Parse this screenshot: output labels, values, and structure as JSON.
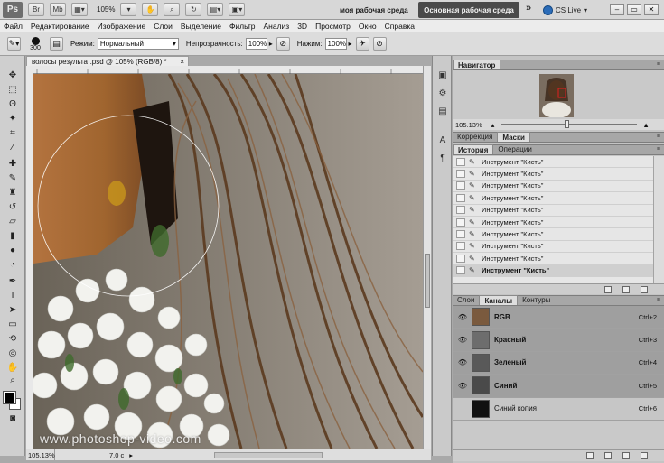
{
  "app": {
    "logo": "Ps",
    "zoom": "105%",
    "current_workspace": "моя рабочая среда",
    "workspace_button": "Основная рабочая среда",
    "more": "»",
    "cs_live": "CS Live"
  },
  "menu": [
    "Файл",
    "Редактирование",
    "Изображение",
    "Слои",
    "Выделение",
    "Фильтр",
    "Анализ",
    "3D",
    "Просмотр",
    "Окно",
    "Справка"
  ],
  "options": {
    "brush_size": "300",
    "mode_label": "Режим:",
    "mode_value": "Нормальный",
    "opacity_label": "Непрозрачность:",
    "opacity_value": "100%",
    "pressure_label": "Нажим:",
    "pressure_value": "100%"
  },
  "document": {
    "tab_title": "волосы результат.psd @ 105% (RGB/8) *",
    "close": "×",
    "status_zoom": "105.13%",
    "status_doc": "7,0 с",
    "watermark": "www.photoshop-video.com"
  },
  "navigator": {
    "title": "Навигатор",
    "zoom": "105.13%"
  },
  "panel_tabs_corr": [
    "Коррекция",
    "Маски"
  ],
  "panel_tabs_hist": [
    "История",
    "Операции"
  ],
  "history": [
    "Инструмент \"Кисть\"",
    "Инструмент \"Кисть\"",
    "Инструмент \"Кисть\"",
    "Инструмент \"Кисть\"",
    "Инструмент \"Кисть\"",
    "Инструмент \"Кисть\"",
    "Инструмент \"Кисть\"",
    "Инструмент \"Кисть\"",
    "Инструмент \"Кисть\"",
    "Инструмент \"Кисть\""
  ],
  "panel_tabs_layers": [
    "Слои",
    "Каналы",
    "Контуры"
  ],
  "channels": [
    {
      "name": "RGB",
      "key": "Ctrl+2"
    },
    {
      "name": "Красный",
      "key": "Ctrl+3"
    },
    {
      "name": "Зеленый",
      "key": "Ctrl+4"
    },
    {
      "name": "Синий",
      "key": "Ctrl+5"
    },
    {
      "name": "Синий копия",
      "key": "Ctrl+6"
    }
  ]
}
